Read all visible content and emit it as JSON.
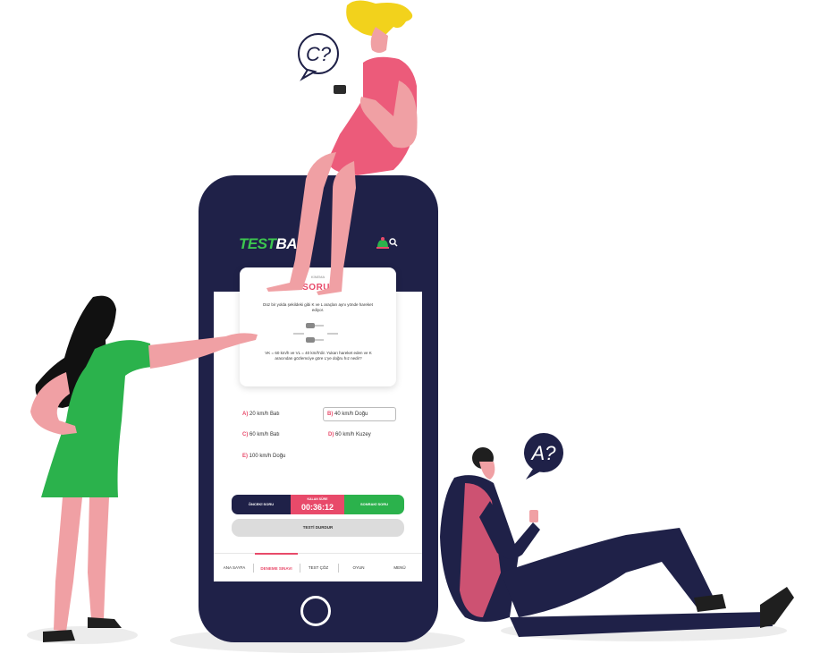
{
  "app": {
    "logo_part1": "TEST",
    "logo_part2": "BAN"
  },
  "question": {
    "subject": "KİNEMA",
    "title": "SORU-",
    "text": "Düz bir yolda şekildeki gibi K ve L araçları aynı yönde hareket ediyor.",
    "text2": "VK = 60 km/h ve VL = 40 km/h'dir. Yukarı hareket eden ve K aracından gözlemciye göre L'ye doğru hız nedir?"
  },
  "answers": [
    {
      "letter": "A)",
      "text": "20 km/h Batı",
      "selected": false
    },
    {
      "letter": "B)",
      "text": "40 km/h Doğu",
      "selected": true
    },
    {
      "letter": "C)",
      "text": "60 km/h Batı",
      "selected": false
    },
    {
      "letter": "D)",
      "text": "60 km/h Kuzey",
      "selected": false
    },
    {
      "letter": "E)",
      "text": "100 km/h Doğu",
      "selected": false
    }
  ],
  "controls": {
    "prev_label": "ÖNCEKİ SORU",
    "timer_label": "KALAN SÜRE",
    "timer_value": "00:36:12",
    "next_label": "SONRAKİ SORU",
    "stop_label": "TESTİ DURDUR"
  },
  "tabs": [
    {
      "label": "ANA SAYFA",
      "active": false
    },
    {
      "label": "DENEME SINAVI",
      "active": true
    },
    {
      "label": "TEST ÇÖZ",
      "active": false
    },
    {
      "label": "OYUN",
      "active": false
    },
    {
      "label": "MENÜ",
      "active": false
    }
  ],
  "bubbles": {
    "top": "C?",
    "right": "A?"
  },
  "colors": {
    "navy": "#1f2148",
    "pink": "#e84a6a",
    "green": "#2bb24c",
    "skin": "#f0a0a4",
    "yellow": "#f2d21c"
  }
}
